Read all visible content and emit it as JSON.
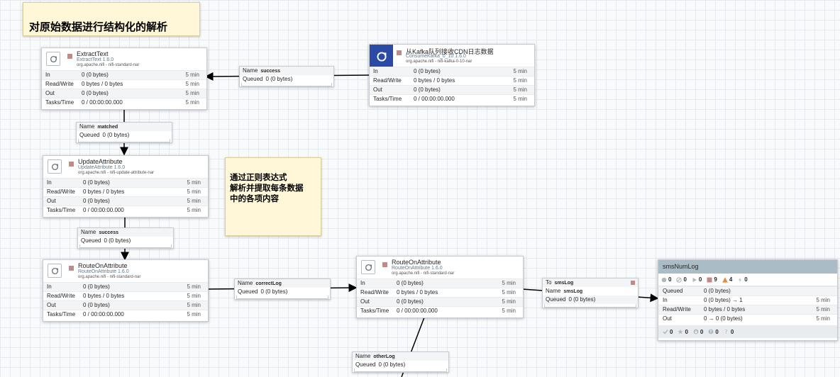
{
  "labels": [
    {
      "text": "对原始数据进行结构化的解析"
    },
    {
      "text": "通过正则表达式\n解析并提取每条数据\n中的各项内容"
    }
  ],
  "processors": [
    {
      "name": "ExtractText",
      "type": "ExtractText 1.6.0",
      "bundle": "org.apache.nifi - nifi-standard-nar",
      "stats": [
        {
          "label": "In",
          "value": "0 (0 bytes)",
          "window": "5 min"
        },
        {
          "label": "Read/Write",
          "value": "0 bytes / 0 bytes",
          "window": "5 min"
        },
        {
          "label": "Out",
          "value": "0 (0 bytes)",
          "window": "5 min"
        },
        {
          "label": "Tasks/Time",
          "value": "0 / 00:00:00.000",
          "window": "5 min"
        }
      ]
    },
    {
      "name": "从Kafka队列接收CDN日志数据",
      "type": "ConsumeKafka_0_10 1.6.0",
      "bundle": "org.apache.nifi - nifi-kafka-0-10-nar",
      "stats": [
        {
          "label": "In",
          "value": "0 (0 bytes)",
          "window": "5 min"
        },
        {
          "label": "Read/Write",
          "value": "0 bytes / 0 bytes",
          "window": "5 min"
        },
        {
          "label": "Out",
          "value": "0 (0 bytes)",
          "window": "5 min"
        },
        {
          "label": "Tasks/Time",
          "value": "0 / 00:00:00.000",
          "window": "5 min"
        }
      ]
    },
    {
      "name": "UpdateAttribute",
      "type": "UpdateAttribute 1.6.0",
      "bundle": "org.apache.nifi - nifi-update-attribute-nar",
      "stats": [
        {
          "label": "In",
          "value": "0 (0 bytes)",
          "window": "5 min"
        },
        {
          "label": "Read/Write",
          "value": "0 bytes / 0 bytes",
          "window": "5 min"
        },
        {
          "label": "Out",
          "value": "0 (0 bytes)",
          "window": "5 min"
        },
        {
          "label": "Tasks/Time",
          "value": "0 / 00:00:00.000",
          "window": "5 min"
        }
      ]
    },
    {
      "name": "RouteOnAttribute",
      "type": "RouteOnAttribute 1.6.0",
      "bundle": "org.apache.nifi - nifi-standard-nar",
      "stats": [
        {
          "label": "In",
          "value": "0 (0 bytes)",
          "window": "5 min"
        },
        {
          "label": "Read/Write",
          "value": "0 bytes / 0 bytes",
          "window": "5 min"
        },
        {
          "label": "Out",
          "value": "0 (0 bytes)",
          "window": "5 min"
        },
        {
          "label": "Tasks/Time",
          "value": "0 / 00:00:00.000",
          "window": "5 min"
        }
      ]
    },
    {
      "name": "RouteOnAttribute",
      "type": "RouteOnAttribute 1.6.0",
      "bundle": "org.apache.nifi - nifi-standard-nar",
      "stats": [
        {
          "label": "In",
          "value": "0 (0 bytes)",
          "window": "5 min"
        },
        {
          "label": "Read/Write",
          "value": "0 bytes / 0 bytes",
          "window": "5 min"
        },
        {
          "label": "Out",
          "value": "0 (0 bytes)",
          "window": "5 min"
        },
        {
          "label": "Tasks/Time",
          "value": "0 / 00:00:00.000",
          "window": "5 min"
        }
      ]
    }
  ],
  "connections": [
    {
      "name_label": "Name",
      "name": "success",
      "queued_label": "Queued",
      "queued": "0 (0 bytes)"
    },
    {
      "name_label": "Name",
      "name": "matched",
      "queued_label": "Queued",
      "queued": "0 (0 bytes)"
    },
    {
      "name_label": "Name",
      "name": "success",
      "queued_label": "Queued",
      "queued": "0 (0 bytes)"
    },
    {
      "name_label": "Name",
      "name": "correctLog",
      "queued_label": "Queued",
      "queued": "0 (0 bytes)"
    },
    {
      "to_label": "To",
      "to": "smsLog",
      "name_label": "Name",
      "name": "smsLog",
      "queued_label": "Queued",
      "queued": "0 (0 bytes)"
    },
    {
      "name_label": "Name",
      "name": "otherLog",
      "queued_label": "Queued",
      "queued": "0 (0 bytes)"
    }
  ],
  "process_group": {
    "name": "smsNumLog",
    "status": {
      "transmitting": "0",
      "not_transmitting": "0",
      "running": "0",
      "stopped": "9",
      "invalid": "4",
      "disabled": "0"
    },
    "stats": [
      {
        "label": "Queued",
        "value": "0 (0 bytes)",
        "window": ""
      },
      {
        "label": "In",
        "value": "0 (0 bytes) → 1",
        "window": "5 min"
      },
      {
        "label": "Read/Write",
        "value": "0 bytes / 0 bytes",
        "window": "5 min"
      },
      {
        "label": "Out",
        "value": "0 → 0 (0 bytes)",
        "window": "5 min"
      }
    ],
    "versions": {
      "up_to_date": "0",
      "locally_modified": "0",
      "stale": "0",
      "modified_stale": "0",
      "sync_failure": "0"
    }
  },
  "colors": {
    "accent_blue": "#2a4aa6",
    "stopped": "#c28a86",
    "invalid": "#e98a3a",
    "pg_header": "#aabcc5",
    "label_bg": "#fff7d7"
  }
}
